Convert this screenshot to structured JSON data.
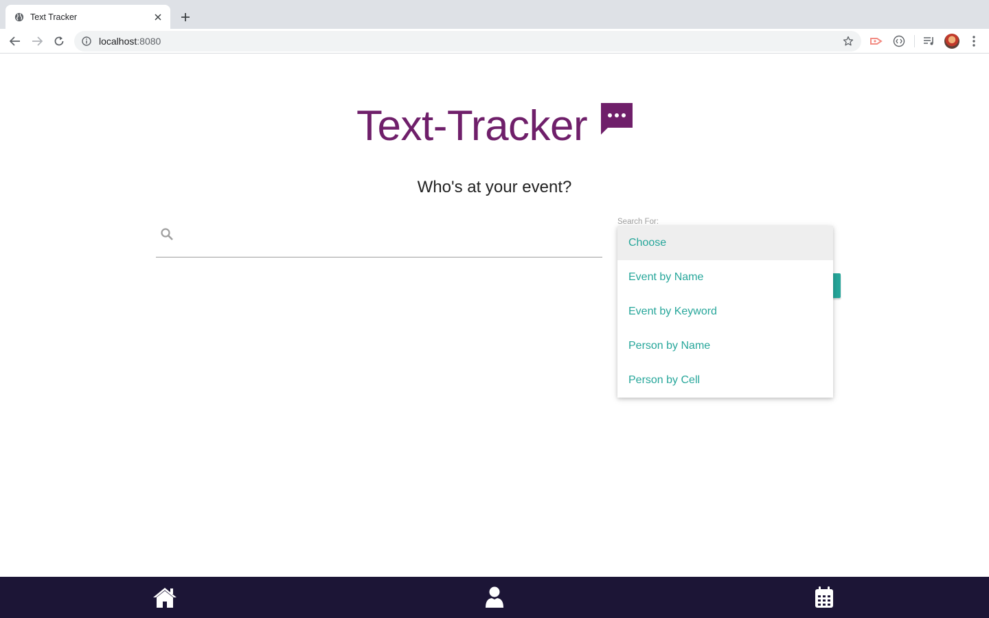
{
  "browser": {
    "tab_title": "Text Tracker",
    "url_host": "localhost",
    "url_port": ":8080"
  },
  "app": {
    "title": "Text-Tracker",
    "subtitle": "Who's at your event?",
    "brand_color": "#6f1f6a",
    "accent_color": "#26a69a",
    "nav_bar_color": "#1c1536"
  },
  "search": {
    "placeholder": "",
    "value": ""
  },
  "search_for": {
    "label": "Search For:",
    "selected": "Choose",
    "options": [
      "Choose",
      "Event by Name",
      "Event by Keyword",
      "Person by Name",
      "Person by Cell"
    ]
  },
  "bottom_nav": {
    "items": [
      "home-icon",
      "person-icon",
      "calendar-icon"
    ]
  }
}
